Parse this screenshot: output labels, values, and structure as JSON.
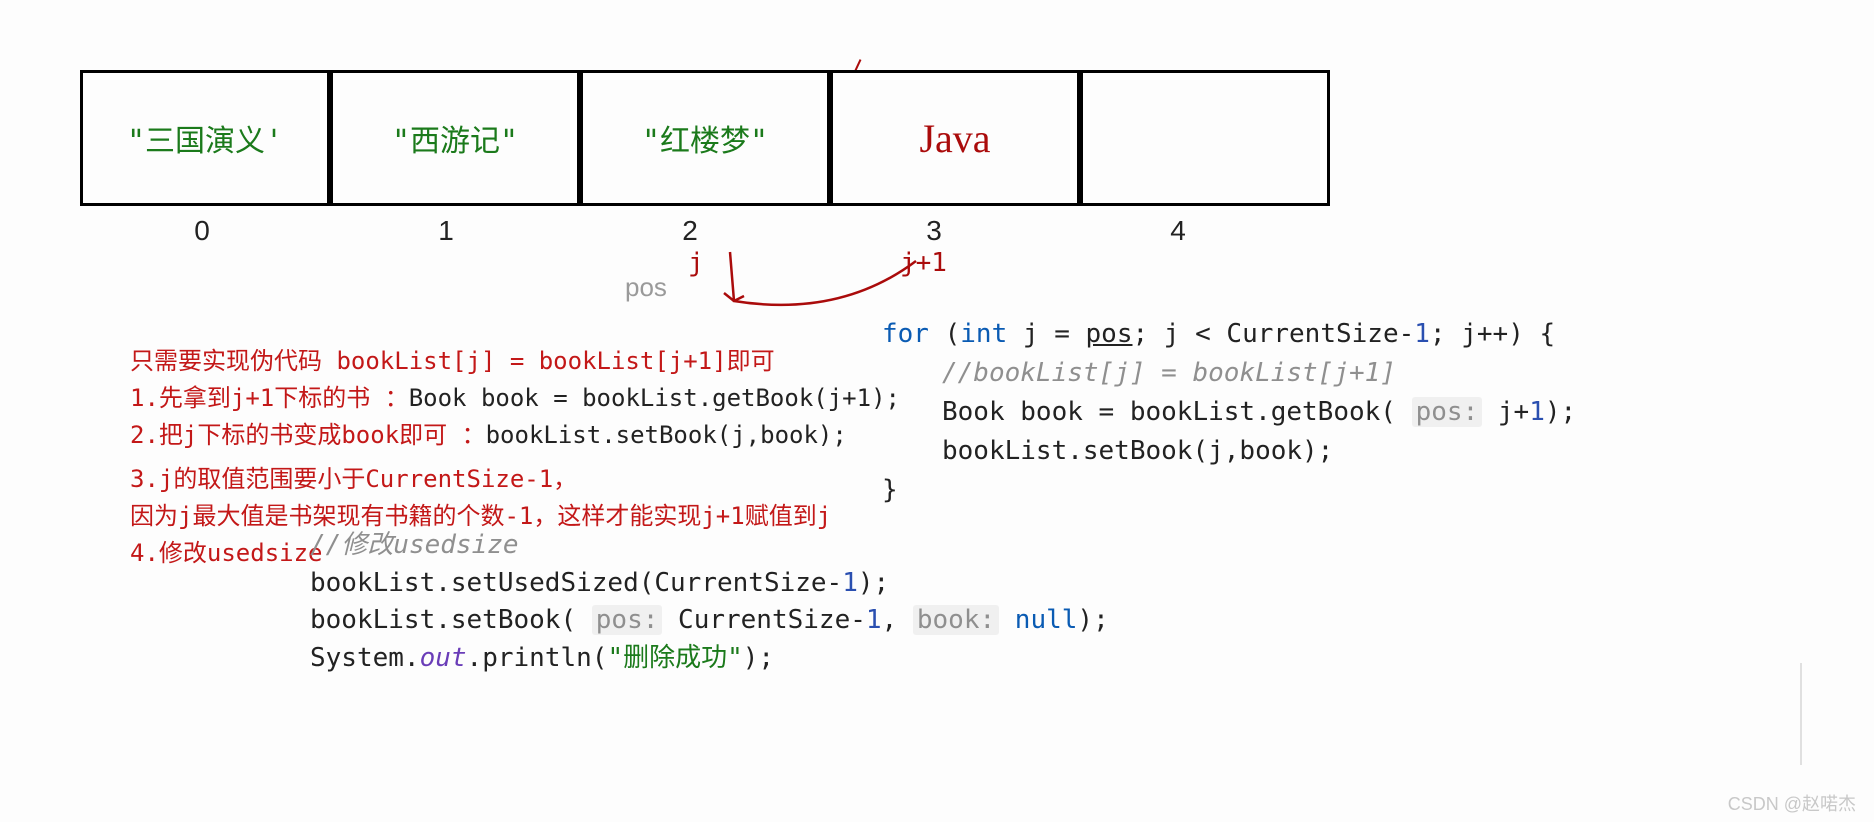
{
  "array": {
    "cells": [
      {
        "label": "\"三国演义'",
        "hand": false
      },
      {
        "label": "\"西游记\"",
        "hand": false
      },
      {
        "label": "\"红楼梦\"",
        "hand": false
      },
      {
        "label": "Java",
        "hand": true
      },
      {
        "label": "",
        "hand": false
      }
    ],
    "indices": [
      "0",
      "1",
      "2",
      "3",
      "4"
    ]
  },
  "ann": {
    "j": "j",
    "j1": "j+1",
    "pos": "pos"
  },
  "explain": {
    "l0": "只需要实现伪代码 bookList[j] = bookList[j+1]即可",
    "l1a": "1.先拿到j+1下标的书 ：",
    "l1b": "Book book = bookList.getBook(j+1);",
    "l2a": "2.把j下标的书变成book即可 ：",
    "l2b": "bookList.setBook(j,book);",
    "l3": "3.j的取值范围要小于CurrentSize-1，",
    "l4": "因为j最大值是书架现有书籍的个数-1，这样才能实现j+1赋值到j",
    "l5": "4.修改usedsize"
  },
  "codeR": {
    "for": "for",
    "int": "int",
    "pos": "pos",
    "cond": "; j < CurrentSize-",
    "one": "1",
    "inc": "; j++) {",
    "com": "//bookList[j] = bookList[j+1]",
    "l1a": "Book book = bookList.getBook( ",
    "posHint": "pos:",
    "l1b": " j+",
    "l1c": ");",
    "l2": "bookList.setBook(j,book);",
    "rb": "}"
  },
  "codeB": {
    "com": "//修改usedsize",
    "l1a": "bookList.setUsedSized(CurrentSize-",
    "one": "1",
    "l1b": ");",
    "l2a": "bookList.setBook( ",
    "posHint": "pos:",
    "l2b": " CurrentSize-",
    "l2c": ", ",
    "bookHint": "book:",
    "nullKw": " null",
    "l2d": ");",
    "l3a": "System.",
    "outField": "out",
    "l3b": ".println(",
    "str": "\"删除成功\"",
    "l3c": ");"
  },
  "watermark": "CSDN @赵喏杰"
}
